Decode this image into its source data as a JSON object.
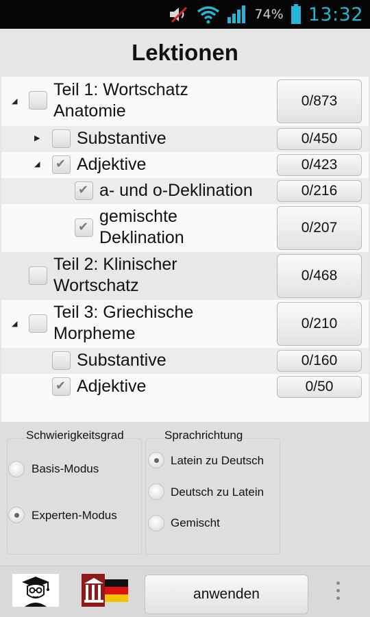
{
  "status_bar": {
    "icons": [
      "mute-icon",
      "wifi-icon",
      "signal-icon",
      "battery-icon"
    ],
    "battery": "74%",
    "time": "13:32",
    "time_color": "#26b5d4"
  },
  "title": "Lektionen",
  "lessons": [
    {
      "label1": "Teil 1: Wortschatz",
      "label2": "Anatomie",
      "count": "0/873",
      "checked": false,
      "expander": "expanded"
    },
    {
      "label1": "Substantive",
      "count": "0/450",
      "checked": false,
      "expander": "collapsed"
    },
    {
      "label1": "Adjektive",
      "count": "0/423",
      "checked": true,
      "expander": "expanded"
    },
    {
      "label1": "a- und o-Deklination",
      "count": "0/216",
      "checked": true
    },
    {
      "label1": "gemischte",
      "label2": "Deklination",
      "count": "0/207",
      "checked": true
    },
    {
      "label1": "Teil 2: Klinischer",
      "label2": "Wortschatz",
      "count": "0/468",
      "checked": false
    },
    {
      "label1": "Teil 3: Griechische",
      "label2": "Morpheme",
      "count": "0/210",
      "checked": false,
      "expander": "expanded"
    },
    {
      "label1": "Substantive",
      "count": "0/160",
      "checked": false
    },
    {
      "label1": "Adjektive",
      "count": "0/50",
      "checked": true
    }
  ],
  "difficulty": {
    "title": "Schwierigkeitsgrad",
    "options": [
      "Basis-Modus",
      "Experten-Modus"
    ],
    "selected": "Experten-Modus"
  },
  "direction": {
    "title": "Sprachrichtung",
    "options": [
      "Latein zu Deutsch",
      "Deutsch zu Latein",
      "Gemischt"
    ],
    "selected": "Latein zu Deutsch"
  },
  "bottom": {
    "apply_label": "anwenden",
    "icons": [
      "student-icon",
      "latin-german-flag-icon",
      "overflow-menu-icon"
    ]
  }
}
